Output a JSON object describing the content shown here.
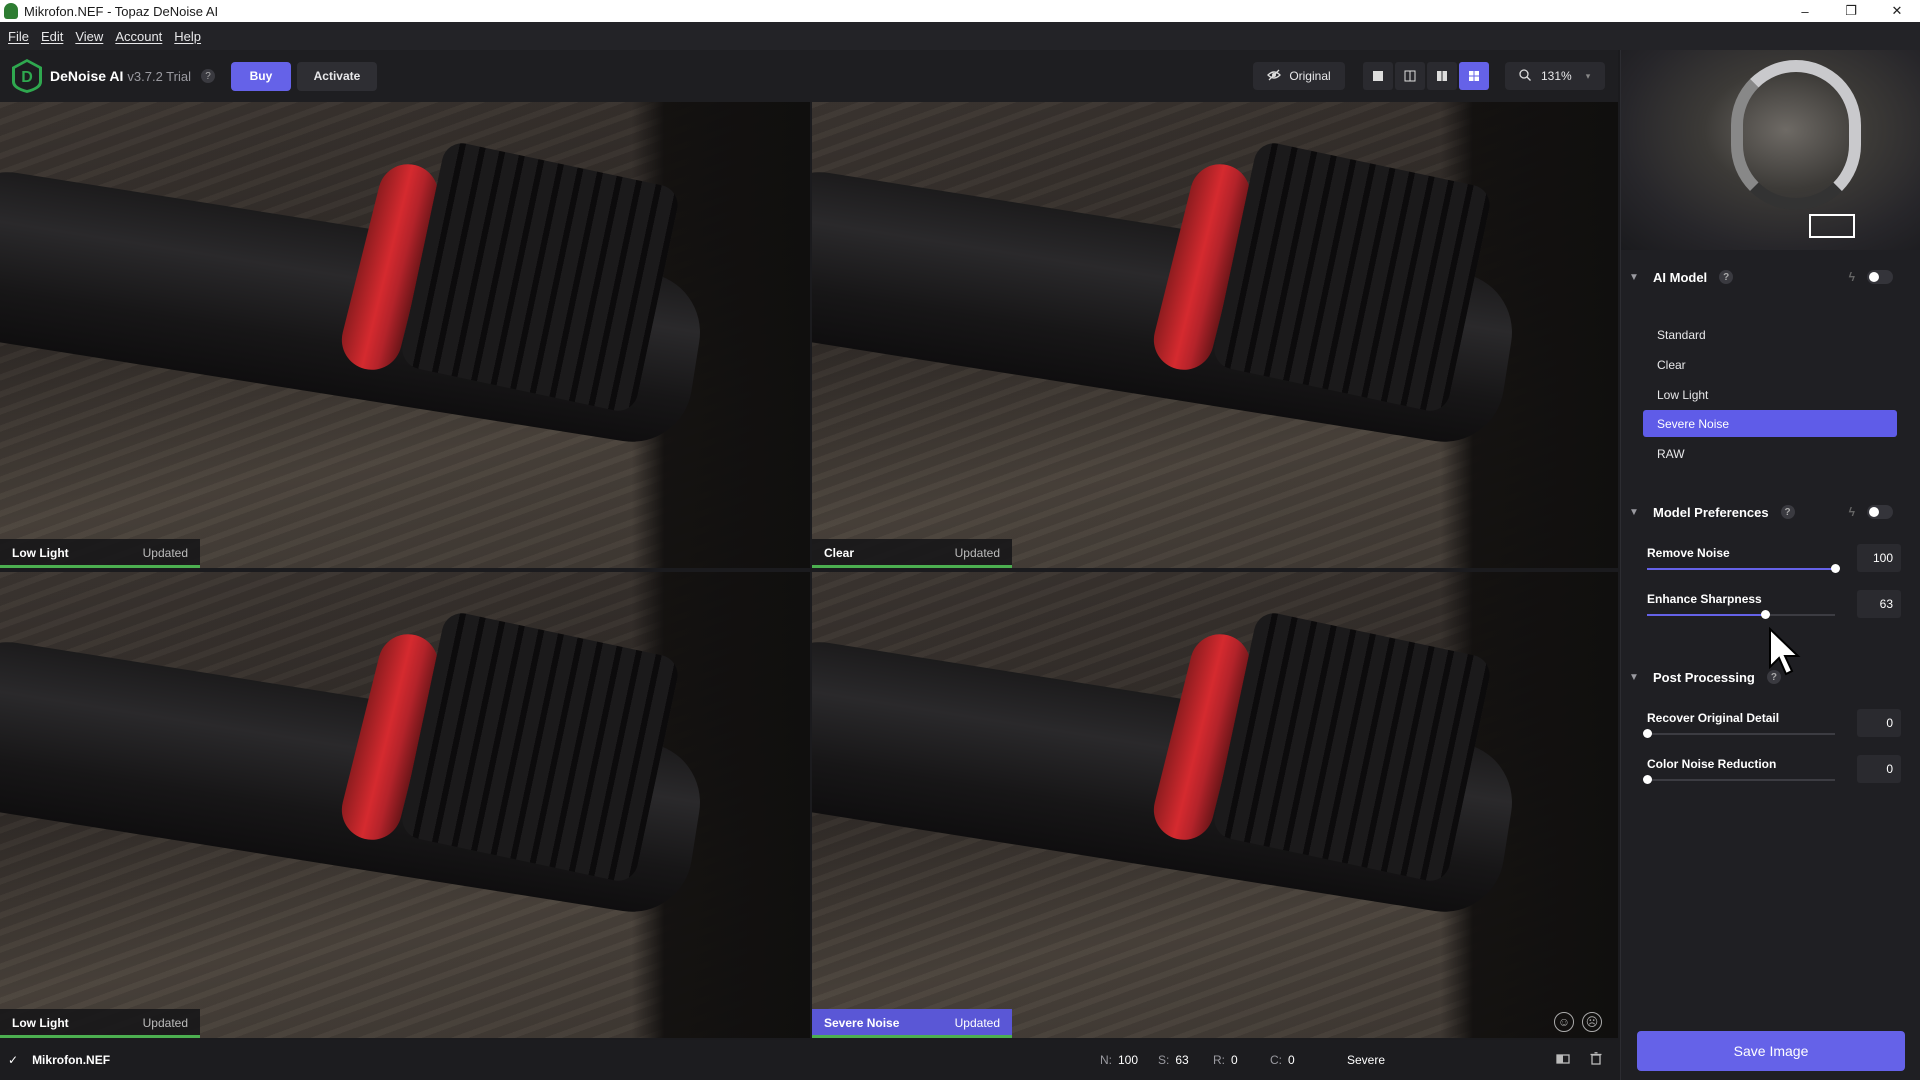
{
  "window": {
    "title": "Mikrofon.NEF - Topaz DeNoise AI",
    "controls": {
      "minimize": "–",
      "restore": "❐",
      "close": "✕"
    }
  },
  "menu": [
    "File",
    "Edit",
    "View",
    "Account",
    "Help"
  ],
  "toolbar": {
    "brand": "DeNoise AI",
    "version": "v3.7.2 Trial",
    "help": "?",
    "buy_label": "Buy",
    "activate_label": "Activate",
    "original_label": "Original",
    "zoom": "131%"
  },
  "panes": [
    {
      "model": "Low Light",
      "status": "Updated"
    },
    {
      "model": "Clear",
      "status": "Updated"
    },
    {
      "model": "Low Light",
      "status": "Updated"
    },
    {
      "model": "Severe Noise",
      "status": "Updated"
    }
  ],
  "right_panel": {
    "ai_model": {
      "title": "AI Model",
      "help": "?",
      "options": [
        "Standard",
        "Clear",
        "Low Light",
        "Severe Noise",
        "RAW"
      ],
      "selected": "Severe Noise"
    },
    "model_preferences": {
      "title": "Model Preferences",
      "help": "?",
      "sliders": [
        {
          "label": "Remove Noise",
          "value": 100
        },
        {
          "label": "Enhance Sharpness",
          "value": 63
        }
      ]
    },
    "post_processing": {
      "title": "Post Processing",
      "help": "?",
      "sliders": [
        {
          "label": "Recover Original Detail",
          "value": 0
        },
        {
          "label": "Color Noise Reduction",
          "value": 0
        }
      ]
    },
    "save_label": "Save Image"
  },
  "statusbar": {
    "check": "✓",
    "filename": "Mikrofon.NEF",
    "n_key": "N:",
    "n_val": "100",
    "s_key": "S:",
    "s_val": "63",
    "r_key": "R:",
    "r_val": "0",
    "c_key": "C:",
    "c_val": "0",
    "mode": "Severe"
  },
  "colors": {
    "accent": "#6562e8",
    "progress": "#4caf50",
    "panel_bg": "#1f1f23"
  }
}
